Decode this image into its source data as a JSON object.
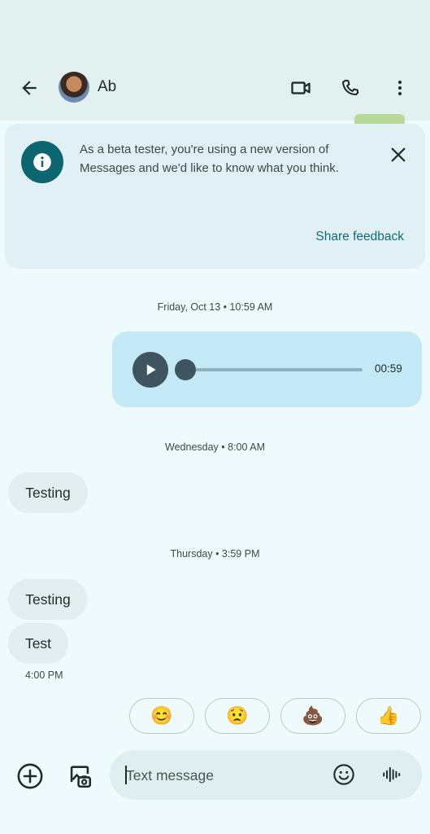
{
  "contact": {
    "name": "Ab"
  },
  "banner": {
    "text": "As a beta tester, you're using a new version of Messages and we'd like to know what you think.",
    "action": "Share feedback"
  },
  "thread": {
    "date1": "Friday, Oct 13 • 10:59 AM",
    "audio_duration": "00:59",
    "date2": "Wednesday • 8:00 AM",
    "msg1": "Testing",
    "date3": "Thursday • 3:59 PM",
    "msg2": "Testing",
    "msg3": "Test",
    "msg3_time": "4:00 PM"
  },
  "reactions": [
    "😊",
    "😟",
    "💩",
    "👍"
  ],
  "compose": {
    "placeholder": "Text message"
  },
  "icons": {
    "back": "arrow-back-icon",
    "video": "video-call-icon",
    "phone": "phone-icon",
    "more": "more-vert-icon",
    "info": "info-icon",
    "close": "close-icon",
    "play": "play-icon",
    "add": "add-circle-icon",
    "gallery": "gallery-icon",
    "emoji": "emoji-icon",
    "voice": "voice-wave-icon"
  },
  "colors": {
    "accent": "#0b6670",
    "audio_bubble": "#c3e9f6",
    "incoming_bubble": "#e2eeef"
  }
}
